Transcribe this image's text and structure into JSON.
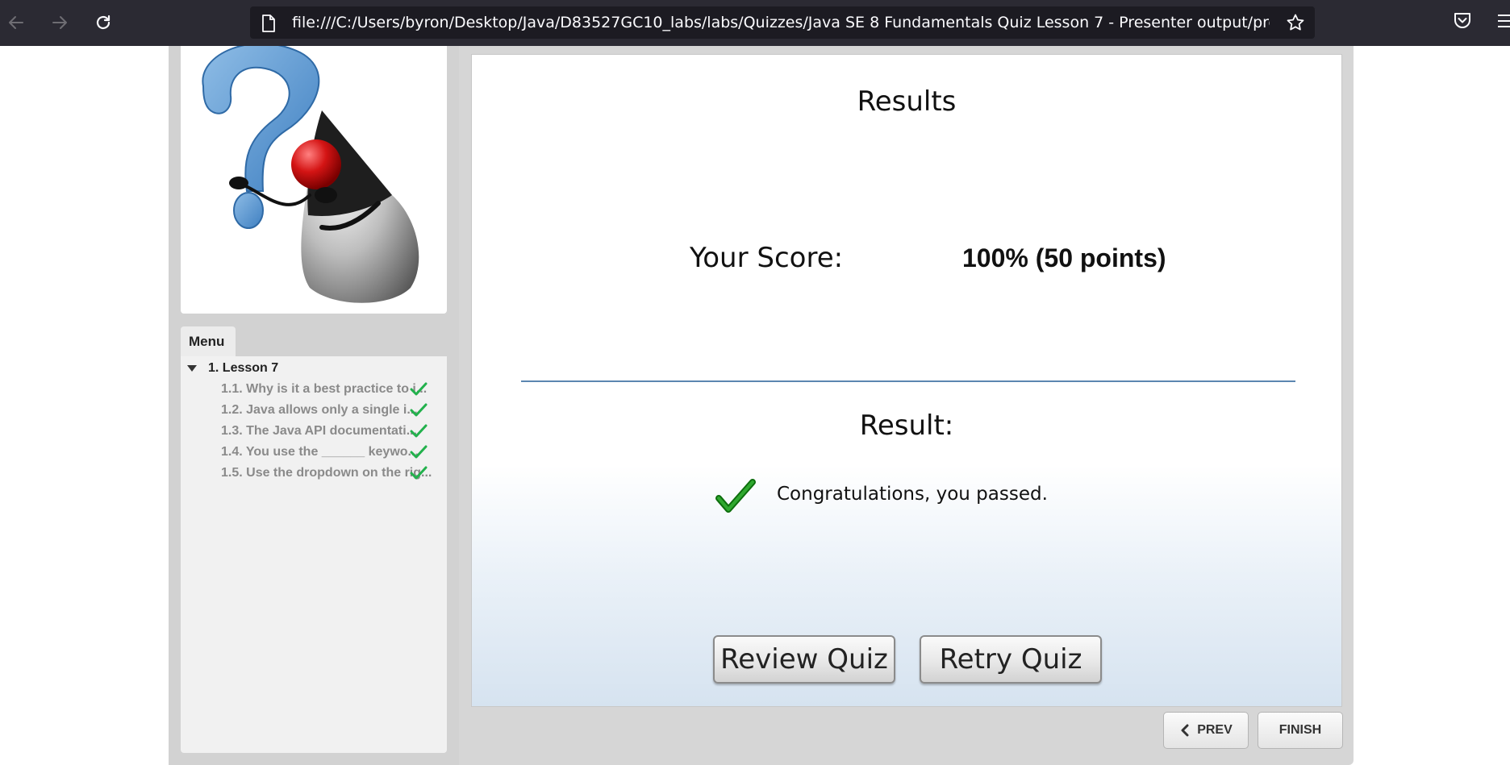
{
  "browser": {
    "url": "file:///C:/Users/byron/Desktop/Java/D83527GC10_labs/labs/Quizzes/Java SE 8 Fundamentals Quiz Lesson 7 - Presenter output/present"
  },
  "sidebar": {
    "menu_tab_label": "Menu",
    "lesson_label": "1. Lesson 7",
    "items": [
      {
        "label": "1.1. Why is it a best practice to i...",
        "status": "checked"
      },
      {
        "label": "1.2. Java allows only a single i...",
        "status": "checked"
      },
      {
        "label": "1.3. The Java API documentati...",
        "status": "checked"
      },
      {
        "label": "1.4. You use the ______ keywo...",
        "status": "checked"
      },
      {
        "label": "1.5. Use the dropdown on the rig...",
        "status": "checked"
      }
    ]
  },
  "results": {
    "title": "Results",
    "score_label": "Your Score:",
    "score_value": "100% (50 points)",
    "result_label": "Result:",
    "result_message": "Congratulations, you passed.",
    "review_button": "Review Quiz",
    "retry_button": "Retry Quiz"
  },
  "navigation": {
    "prev_label": "PREV",
    "finish_label": "FINISH"
  },
  "colors": {
    "accent_check": "#1e8c1e",
    "divider": "#5b86b0",
    "browser_bar": "#2b2a33"
  }
}
